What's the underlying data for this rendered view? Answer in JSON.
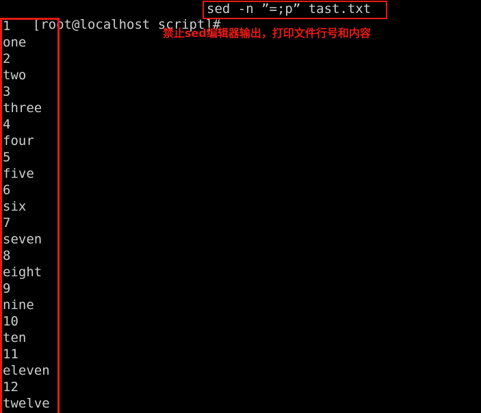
{
  "terminal": {
    "background_color": "#000000",
    "text_color": "#cfcfcf",
    "highlight_color": "#e81b14",
    "prompt": "[root@localhost script]#",
    "command": "sed -n ”=;p” tast.txt",
    "annotation": "禁止sed编辑器输出，打印文件行号和内容",
    "output_lines": [
      "1",
      "one",
      "2",
      "two",
      "3",
      "three",
      "4",
      "four",
      "5",
      "five",
      "6",
      "six",
      "7",
      "seven",
      "8",
      "eight",
      "9",
      "nine",
      "10",
      "ten",
      "11",
      "eleven",
      "12",
      "twelve"
    ]
  }
}
